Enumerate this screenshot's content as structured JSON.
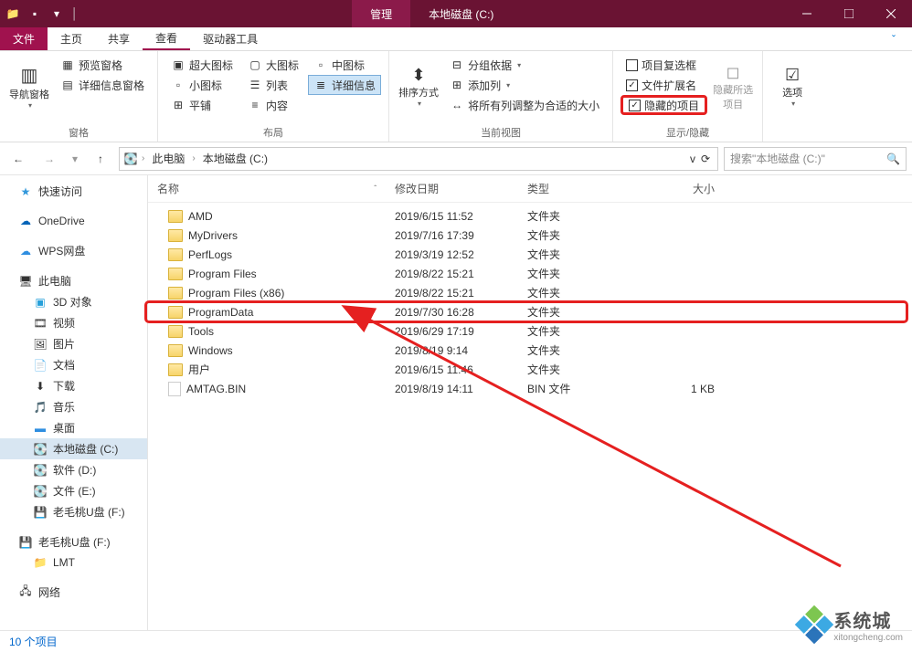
{
  "titlebar": {
    "context_tab": "管理",
    "title": "本地磁盘 (C:)"
  },
  "menutabs": {
    "file": "文件",
    "home": "主页",
    "share": "共享",
    "view": "查看",
    "drive": "驱动器工具"
  },
  "ribbon": {
    "panes": {
      "nav_pane": "导航窗格",
      "preview_pane": "预览窗格",
      "details_pane": "详细信息窗格",
      "group_label": "窗格"
    },
    "layout": {
      "extra_large": "超大图标",
      "large": "大图标",
      "medium": "中图标",
      "small": "小图标",
      "list": "列表",
      "details": "详细信息",
      "tiles": "平铺",
      "content": "内容",
      "group_label": "布局"
    },
    "current_view": {
      "sort_by": "排序方式",
      "group_by": "分组依据",
      "add_columns": "添加列",
      "size_all": "将所有列调整为合适的大小",
      "group_label": "当前视图"
    },
    "show_hide": {
      "item_checkboxes": "项目复选框",
      "file_ext": "文件扩展名",
      "hidden_items": "隐藏的项目",
      "hide_selected": "隐藏所选项目",
      "group_label": "显示/隐藏"
    },
    "options": "选项"
  },
  "breadcrumb": {
    "this_pc": "此电脑",
    "drive": "本地磁盘 (C:)"
  },
  "search": {
    "placeholder": "搜索\"本地磁盘 (C:)\""
  },
  "columns": {
    "name": "名称",
    "date": "修改日期",
    "type": "类型",
    "size": "大小"
  },
  "sidebar": {
    "quick_access": "快速访问",
    "onedrive": "OneDrive",
    "wps": "WPS网盘",
    "this_pc": "此电脑",
    "objects_3d": "3D 对象",
    "videos": "视频",
    "pictures": "图片",
    "documents": "文档",
    "downloads": "下载",
    "music": "音乐",
    "desktop": "桌面",
    "local_c": "本地磁盘 (C:)",
    "soft_d": "软件 (D:)",
    "file_e": "文件 (E:)",
    "usb_f": "老毛桃U盘 (F:)",
    "usb_f2": "老毛桃U盘 (F:)",
    "lmt": "LMT",
    "network": "网络"
  },
  "files": [
    {
      "name": "AMD",
      "date": "2019/6/15 11:52",
      "type": "文件夹",
      "size": "",
      "icon": "folder"
    },
    {
      "name": "MyDrivers",
      "date": "2019/7/16 17:39",
      "type": "文件夹",
      "size": "",
      "icon": "folder"
    },
    {
      "name": "PerfLogs",
      "date": "2019/3/19 12:52",
      "type": "文件夹",
      "size": "",
      "icon": "folder"
    },
    {
      "name": "Program Files",
      "date": "2019/8/22 15:21",
      "type": "文件夹",
      "size": "",
      "icon": "folder"
    },
    {
      "name": "Program Files (x86)",
      "date": "2019/8/22 15:21",
      "type": "文件夹",
      "size": "",
      "icon": "folder"
    },
    {
      "name": "ProgramData",
      "date": "2019/7/30 16:28",
      "type": "文件夹",
      "size": "",
      "icon": "folder",
      "highlighted": true
    },
    {
      "name": "Tools",
      "date": "2019/6/29 17:19",
      "type": "文件夹",
      "size": "",
      "icon": "folder"
    },
    {
      "name": "Windows",
      "date": "2019/8/19 9:14",
      "type": "文件夹",
      "size": "",
      "icon": "folder"
    },
    {
      "name": "用户",
      "date": "2019/6/15 11:46",
      "type": "文件夹",
      "size": "",
      "icon": "folder"
    },
    {
      "name": "AMTAG.BIN",
      "date": "2019/8/19 14:11",
      "type": "BIN 文件",
      "size": "1 KB",
      "icon": "file"
    }
  ],
  "statusbar": {
    "count": "10 个项目"
  },
  "watermark": {
    "text": "系统城",
    "url": "xitongcheng.com"
  }
}
